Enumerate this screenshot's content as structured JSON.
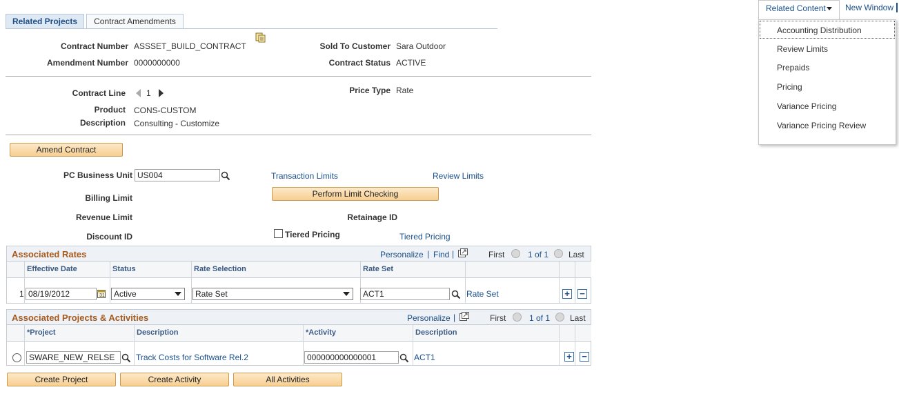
{
  "tabs": [
    "Related Projects",
    "Contract Amendments"
  ],
  "header_fields": {
    "contract_number_label": "Contract Number",
    "contract_number": "ASSSET_BUILD_CONTRACT",
    "amendment_number_label": "Amendment Number",
    "amendment_number": "0000000000",
    "sold_to_label": "Sold To Customer",
    "sold_to": "Sara Outdoor",
    "status_label": "Contract Status",
    "status": "ACTIVE"
  },
  "line_fields": {
    "contract_line_label": "Contract Line",
    "contract_line": "1",
    "price_type_label": "Price Type",
    "price_type": "Rate",
    "product_label": "Product",
    "product": "CONS-CUSTOM",
    "description_label": "Description",
    "description": "Consulting - Customize"
  },
  "amend_button": "Amend Contract",
  "limits": {
    "pc_bu_label": "PC Business Unit",
    "pc_bu_value": "US004",
    "transaction_limits": "Transaction Limits",
    "review_limits": "Review Limits",
    "perform_button": "Perform Limit Checking",
    "billing_limit_label": "Billing Limit",
    "revenue_limit_label": "Revenue Limit",
    "retainage_label": "Retainage ID",
    "discount_label": "Discount ID",
    "tiered_checkbox_label": "Tiered Pricing",
    "tiered_link": "Tiered Pricing"
  },
  "rates_grid": {
    "title": "Associated Rates",
    "personalize": "Personalize",
    "find": "Find",
    "first": "First",
    "paging": "1 of 1",
    "last": "Last",
    "columns": [
      "Effective Date",
      "Status",
      "Rate Selection",
      "Rate Set"
    ],
    "row": {
      "num": "1",
      "effective_date": "08/19/2012",
      "status": "Active",
      "rate_selection": "Rate Set",
      "rate_set": "ACT1",
      "rate_set_link": "Rate Set"
    }
  },
  "projects_grid": {
    "title": "Associated Projects & Activities",
    "personalize": "Personalize",
    "first": "First",
    "paging": "1 of 1",
    "last": "Last",
    "columns": [
      "*Project",
      "Description",
      "*Activity",
      "Description"
    ],
    "row": {
      "project": "SWARE_NEW_RELSE",
      "project_desc": "Track Costs for Software Rel.2",
      "activity": "000000000000001",
      "activity_desc": "ACT1"
    }
  },
  "bottom_buttons": [
    "Create Project",
    "Create Activity",
    "All Activities"
  ],
  "top_links": {
    "related_content": "Related Content",
    "new_window": "New Window"
  },
  "related_menu": [
    "Accounting Distribution",
    "Review Limits",
    "Prepaids",
    "Pricing",
    "Variance Pricing",
    "Variance Pricing Review"
  ]
}
